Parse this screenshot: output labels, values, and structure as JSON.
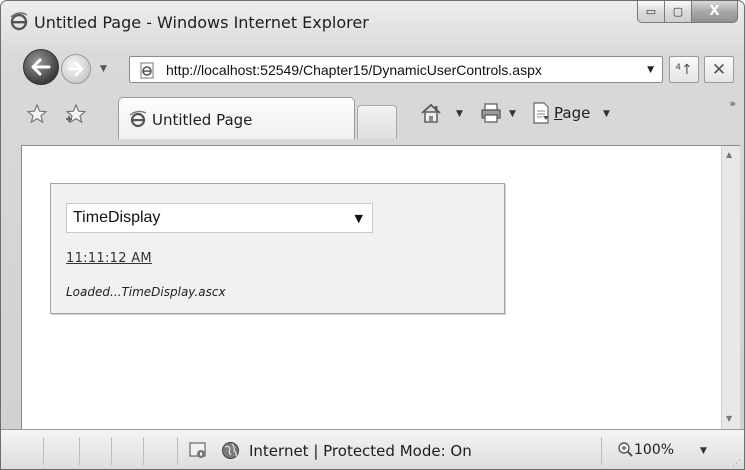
{
  "window": {
    "title": "Untitled Page - Windows Internet Explorer"
  },
  "caption_buttons": {
    "minimize_glyph": "▭",
    "maximize_glyph": "▢",
    "close_glyph": "X"
  },
  "navigation": {
    "back_icon": "back-arrow-icon",
    "forward_icon": "forward-arrow-icon",
    "address_url": "http://localhost:52549/Chapter15/DynamicUserControls.aspx",
    "refresh_glyph": "⁴↑",
    "stop_glyph": "✕"
  },
  "tabs": {
    "items": [
      {
        "label": "Untitled Page"
      }
    ]
  },
  "command_bar": {
    "page_label_prefix": "P",
    "page_label_rest": "age"
  },
  "page": {
    "dropdown": {
      "selected": "TimeDisplay"
    },
    "time_link": "11:11:12 AM",
    "loaded_message": "Loaded...TimeDisplay.ascx"
  },
  "status_bar": {
    "zone_text": "Internet | Protected Mode: On",
    "zoom_text": "100%"
  },
  "colors": {
    "chrome": "#d9d9d9",
    "panel_background": "#f1f1f1",
    "link": "#333333"
  }
}
